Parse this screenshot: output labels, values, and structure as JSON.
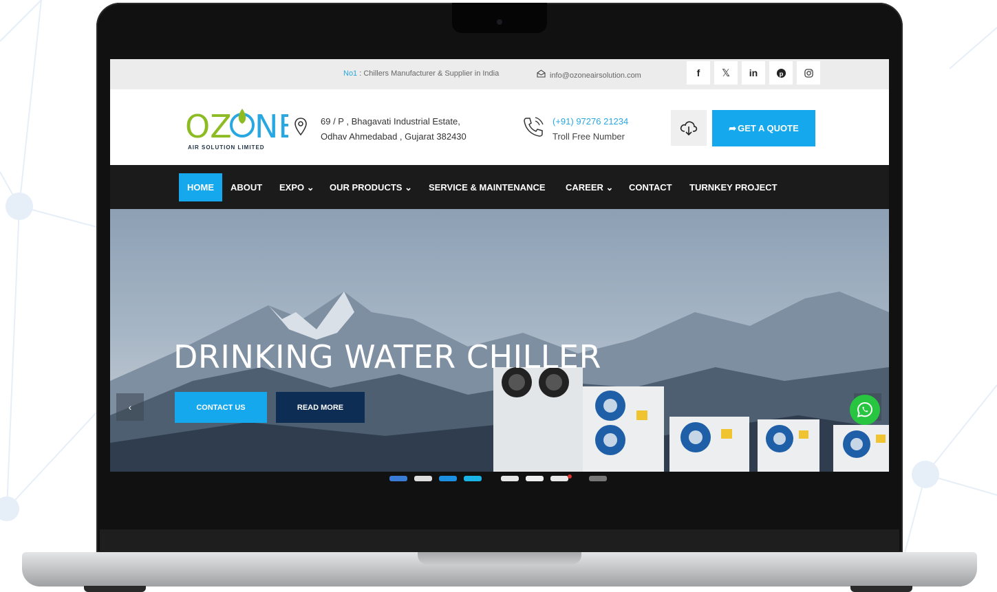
{
  "topbar": {
    "tag_prefix": "No1",
    "tag_text": " : Chillers Manufacturer & Supplier in India",
    "email": "info@ozoneairsolution.com",
    "socials": [
      "facebook-icon",
      "x-icon",
      "linkedin-icon",
      "pinterest-icon",
      "instagram-icon"
    ]
  },
  "header": {
    "logo_main": "OZONE",
    "logo_sub": "AIR SOLUTION LIMITED",
    "address_line1": "69 / P , Bhagavati Industrial Estate,",
    "address_line2": "Odhav Ahmedabad , Gujarat 382430",
    "phone": "(+91) 97276 21234",
    "phone_label": "Troll Free Number",
    "quote_label": "GET A QUOTE"
  },
  "nav": {
    "items": [
      "HOME",
      "ABOUT",
      "EXPO",
      "OUR PRODUCTS",
      "SERVICE & MAINTENANCE",
      "CAREER",
      "CONTACT",
      "TURNKEY PROJECT"
    ],
    "active": "HOME"
  },
  "hero": {
    "title": "DRINKING WATER CHILLER",
    "contact_label": "CONTACT US",
    "read_label": "READ MORE",
    "prev_label": "‹"
  },
  "colors": {
    "accent": "#15a8ec",
    "navy": "#0d2d55",
    "nav_bg": "#1b1b1b",
    "logo_green": "#8dbb24",
    "whatsapp": "#28c541"
  }
}
